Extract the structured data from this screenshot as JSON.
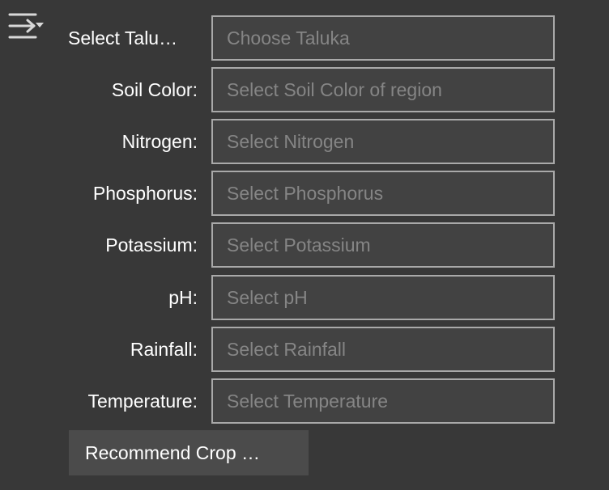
{
  "header": {
    "toggle_icon": "collapse-form-toggle-icon"
  },
  "form": {
    "fields": [
      {
        "label": "Select Talu…",
        "placeholder": "Choose Taluka",
        "value": ""
      },
      {
        "label": "Soil Color:",
        "placeholder": "Select Soil Color of region",
        "value": ""
      },
      {
        "label": "Nitrogen:",
        "placeholder": "Select Nitrogen",
        "value": ""
      },
      {
        "label": "Phosphorus:",
        "placeholder": "Select Phosphorus",
        "value": ""
      },
      {
        "label": "Potassium:",
        "placeholder": "Select Potassium",
        "value": ""
      },
      {
        "label": "pH:",
        "placeholder": "Select pH",
        "value": ""
      },
      {
        "label": "Rainfall:",
        "placeholder": "Select Rainfall",
        "value": ""
      },
      {
        "label": "Temperature:",
        "placeholder": "Select Temperature",
        "value": ""
      }
    ],
    "submit_label": "Recommend Crop …"
  },
  "colors": {
    "background": "#383838",
    "input_background": "#424242",
    "input_border": "#a9a9a9",
    "placeholder": "#858585",
    "button_background": "#4b4b4b",
    "text": "#ffffff"
  }
}
